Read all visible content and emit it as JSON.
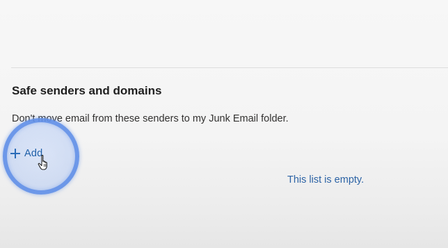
{
  "section": {
    "title": "Safe senders and domains",
    "description": "Don't move email from these senders to my Junk Email folder."
  },
  "actions": {
    "add_label": "Add",
    "add_icon": "plus-icon"
  },
  "list": {
    "empty_text": "This list is empty."
  },
  "overlay": {
    "cursor_icon": "hand-pointer-icon",
    "highlight_color": "#5c8ce6"
  },
  "colors": {
    "link": "#1e5fa8",
    "text": "#323130",
    "title": "#1f1f1f"
  }
}
